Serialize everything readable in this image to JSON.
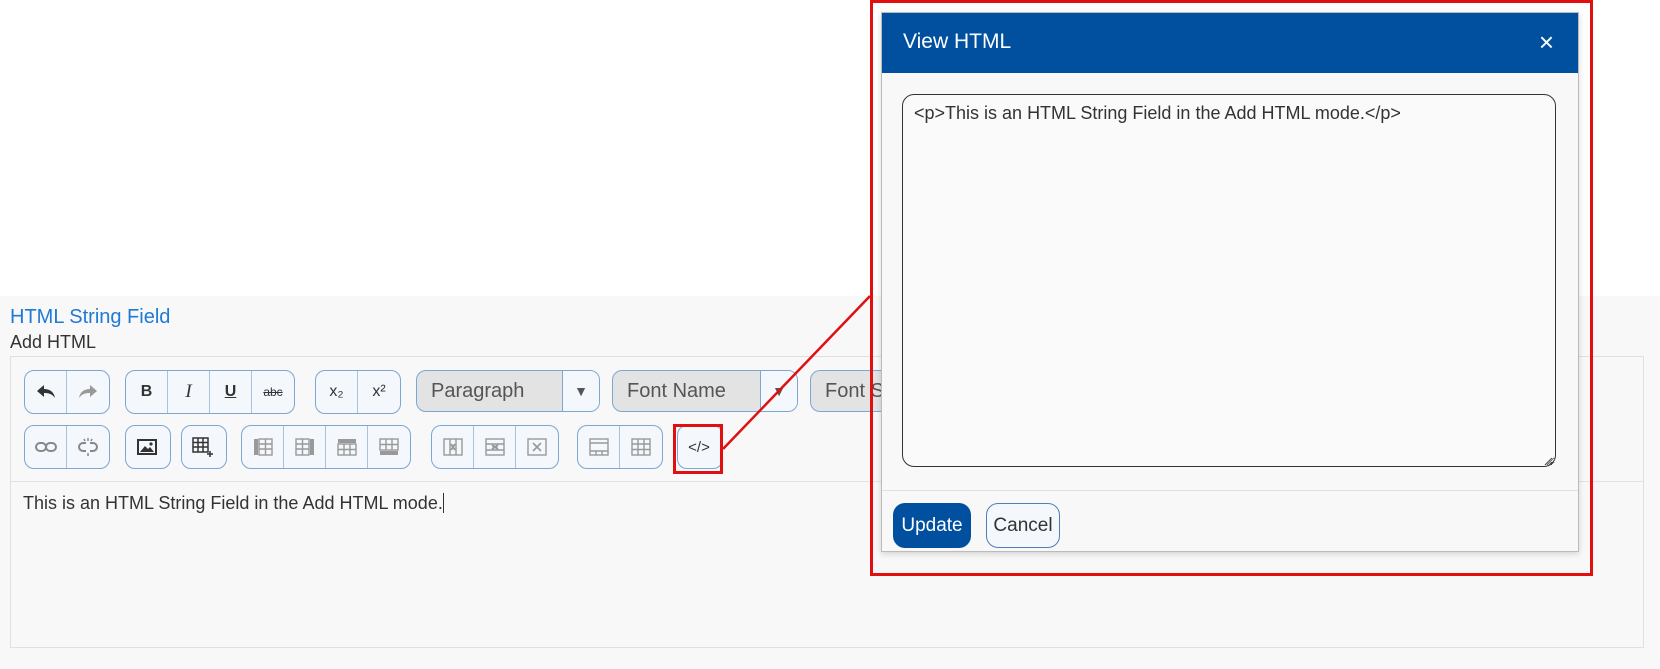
{
  "field": {
    "title": "HTML String Field",
    "subtitle": "Add HTML"
  },
  "toolbar": {
    "format_select": "Paragraph",
    "font_name_select": "Font Name",
    "font_size_select": "Font Si",
    "buttons": {
      "undo": "undo-icon",
      "redo": "redo-icon",
      "bold": "B",
      "italic": "I",
      "underline": "U",
      "strikethrough": "abc",
      "subscript": "x₂",
      "superscript": "x²",
      "view_html": "</>"
    }
  },
  "editor": {
    "content": "This is an HTML String Field in the Add HTML mode."
  },
  "dialog": {
    "title": "View HTML",
    "close_label": "×",
    "html_value": "<p>This is an HTML String Field in the Add HTML mode.</p>",
    "update_label": "Update",
    "cancel_label": "Cancel"
  },
  "colors": {
    "accent": "#0150a0",
    "title_link": "#1f7ad6",
    "highlight": "#e01010"
  }
}
